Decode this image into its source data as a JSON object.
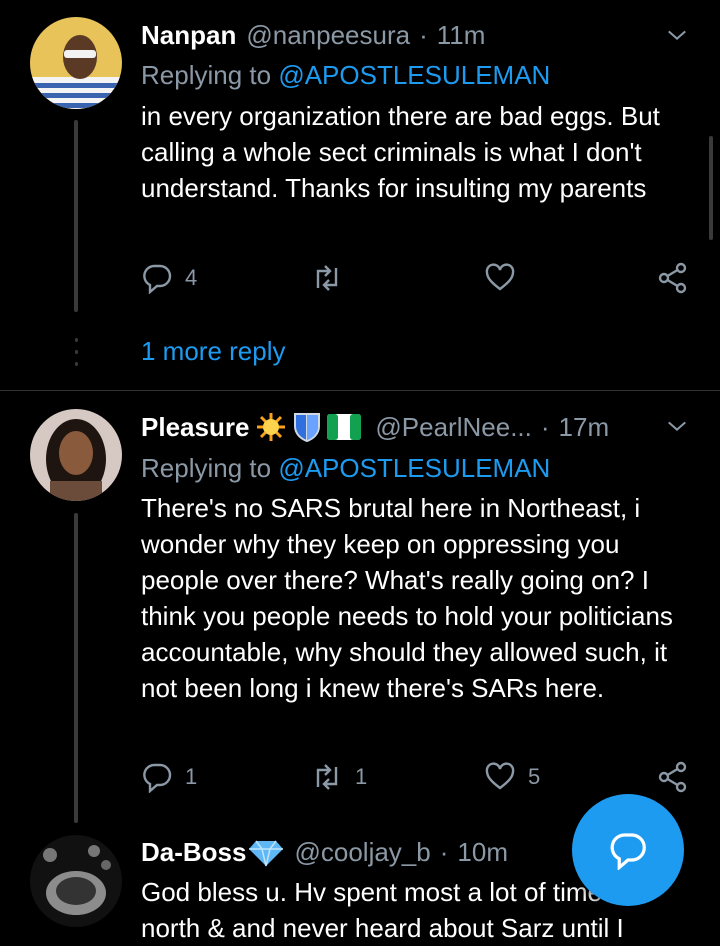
{
  "tweets": [
    {
      "name": "Nanpan",
      "handle": "@nanpeesura",
      "separator": "·",
      "time": "11m",
      "replying_prefix": "Replying to",
      "replying_to": "@APOSTLESULEMAN",
      "text": "in every organization there are bad eggs. But calling a whole sect criminals is what I don't understand. Thanks for insulting my parents",
      "reply_count": "4",
      "retweet_count": "",
      "like_count": "",
      "more_replies": "1 more reply"
    },
    {
      "name": "Pleasure",
      "handle": "@PearlNee...",
      "separator": "·",
      "time": "17m",
      "replying_prefix": "Replying to",
      "replying_to": "@APOSTLESULEMAN",
      "text": "There's no SARS brutal here in Northeast, i wonder why they keep on oppressing you people over there? What's really going on? I think you people needs to hold your politicians accountable, why should they allowed such, it not been long i knew there's SARs here.",
      "reply_count": "1",
      "retweet_count": "1",
      "like_count": "5"
    },
    {
      "name": "Da-Boss",
      "handle": "@cooljay_b",
      "separator": "·",
      "time": "10m",
      "text": "God bless u. Hv spent most a lot of time in north & and never heard about Sarz until I"
    }
  ],
  "colors": {
    "accent": "#1d9bf0",
    "muted": "#8b98a5",
    "background": "#000000"
  },
  "icons": [
    "reply-icon",
    "retweet-icon",
    "like-icon",
    "share-icon",
    "chevron-down-icon",
    "compose-reply-icon",
    "sun-emoji",
    "shield-emoji",
    "nigeria-flag-emoji",
    "diamond-emoji"
  ]
}
